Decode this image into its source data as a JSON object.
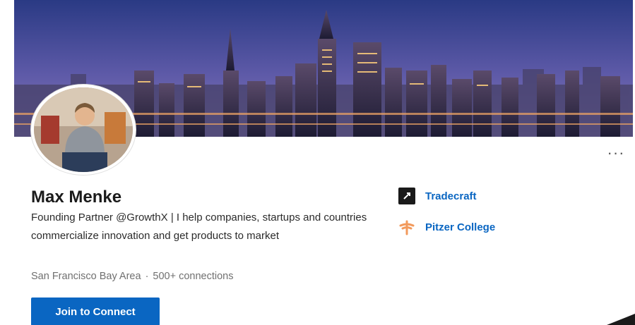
{
  "profile": {
    "name": "Max Menke",
    "headline": "Founding Partner @GrowthX | I help companies, startups and countries commercialize innovation and get products to market",
    "location": "San Francisco Bay Area",
    "separator": "·",
    "connections": "500+ connections"
  },
  "actions": {
    "join_label": "Join to Connect",
    "more_label": "···"
  },
  "organizations": [
    {
      "label": "Tradecraft",
      "icon": "tradecraft-logo-icon"
    },
    {
      "label": "Pitzer College",
      "icon": "pitzer-college-logo-icon"
    }
  ],
  "colors": {
    "brand_blue": "#0a66c2",
    "banner_sky_top": "#2f3e86",
    "banner_sky_bottom": "#7f74b8"
  }
}
